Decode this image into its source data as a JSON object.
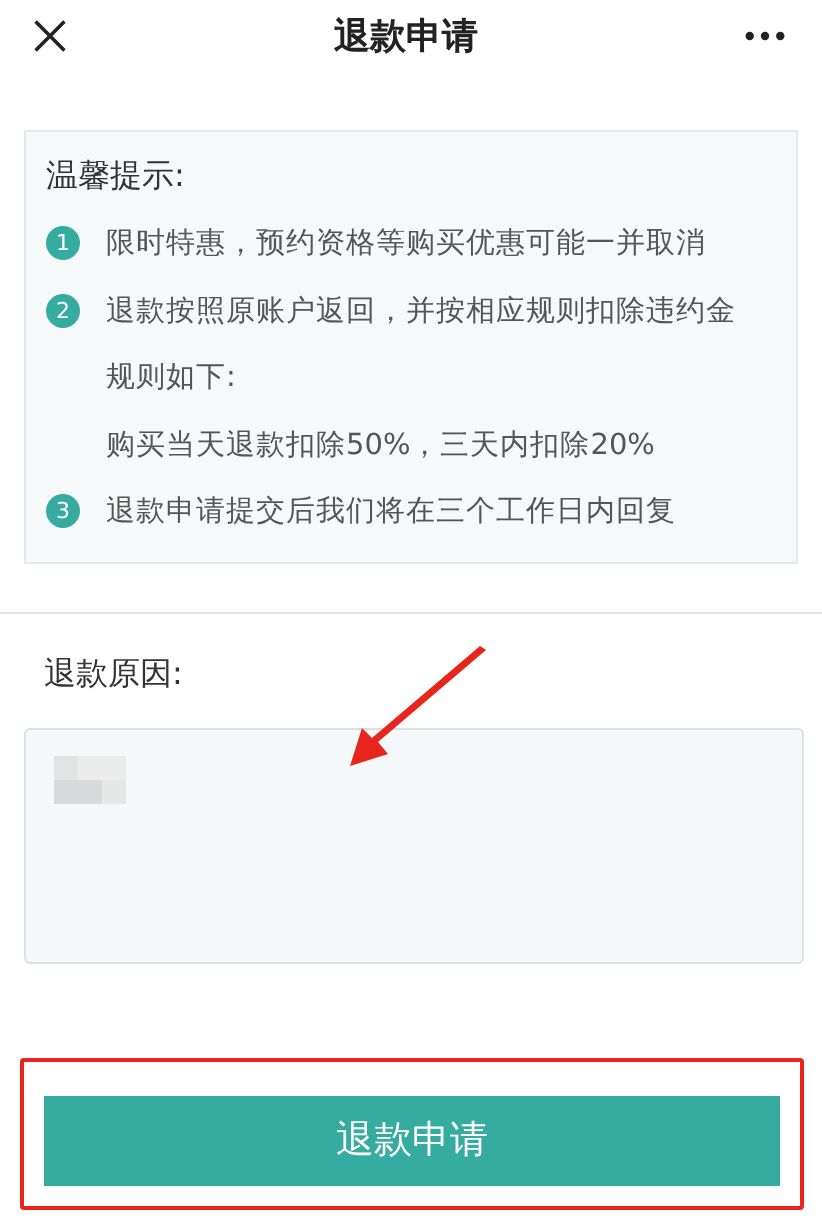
{
  "header": {
    "title": "退款申请"
  },
  "notice": {
    "heading": "温馨提示:",
    "items": [
      {
        "number": "1",
        "lines": [
          "限时特惠，预约资格等购买优惠可能一并取消"
        ]
      },
      {
        "number": "2",
        "lines": [
          "退款按照原账户返回，并按相应规则扣除违约金",
          "规则如下:",
          "购买当天退款扣除50%，三天内扣除20%"
        ]
      },
      {
        "number": "3",
        "lines": [
          "退款申请提交后我们将在三个工作日内回复"
        ]
      }
    ]
  },
  "reason": {
    "label": "退款原因:"
  },
  "submit_button": "退款申请"
}
